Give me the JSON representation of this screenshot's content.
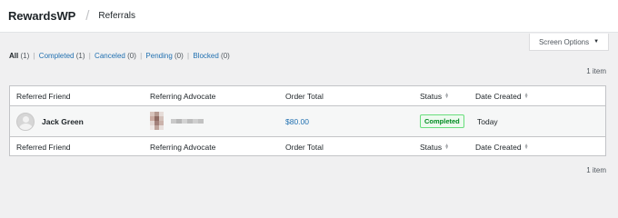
{
  "header": {
    "brand": "RewardsWP",
    "separator": "/",
    "page": "Referrals"
  },
  "screen_options": {
    "label": "Screen Options"
  },
  "filters": [
    {
      "label": "All",
      "count": "(1)",
      "current": true
    },
    {
      "label": "Completed",
      "count": "(1)",
      "current": false
    },
    {
      "label": "Canceled",
      "count": "(0)",
      "current": false
    },
    {
      "label": "Pending",
      "count": "(0)",
      "current": false
    },
    {
      "label": "Blocked",
      "count": "(0)",
      "current": false
    }
  ],
  "item_count": "1 item",
  "table": {
    "columns": [
      "Referred Friend",
      "Referring Advocate",
      "Order Total",
      "Status",
      "Date Created"
    ],
    "rows": [
      {
        "friend": "Jack Green",
        "advocate": "",
        "order_total": "$80.00",
        "status": "Completed",
        "date": "Today"
      }
    ]
  },
  "colors": {
    "link": "#2271b1",
    "status_completed": "#008a20",
    "status_border": "#68de7c"
  }
}
